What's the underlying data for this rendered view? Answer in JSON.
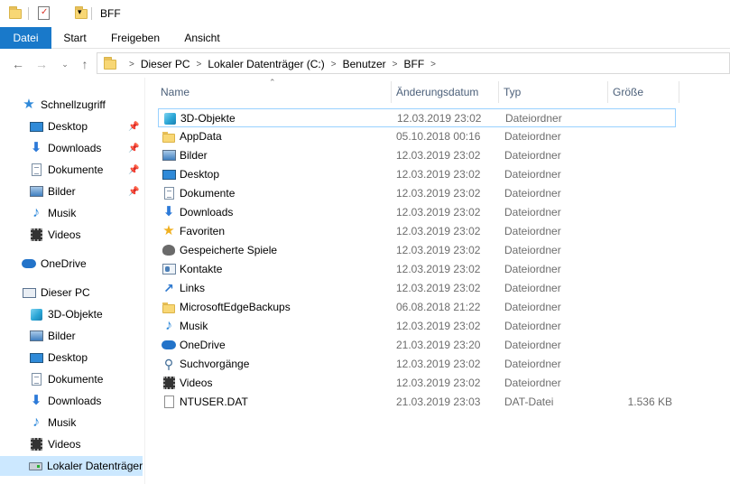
{
  "window": {
    "title": "BFF"
  },
  "ribbon": {
    "tabs": [
      "Datei",
      "Start",
      "Freigeben",
      "Ansicht"
    ]
  },
  "address": {
    "crumbs": [
      "Dieser PC",
      "Lokaler Datenträger (C:)",
      "Benutzer",
      "BFF"
    ]
  },
  "sidebar": {
    "quick_access": "Schnellzugriff",
    "quick_items": [
      "Desktop",
      "Downloads",
      "Dokumente",
      "Bilder",
      "Musik",
      "Videos"
    ],
    "onedrive": "OneDrive",
    "this_pc": "Dieser PC",
    "pc_items": [
      "3D-Objekte",
      "Bilder",
      "Desktop",
      "Dokumente",
      "Downloads",
      "Musik",
      "Videos",
      "Lokaler Datenträger"
    ]
  },
  "columns": {
    "name": "Name",
    "date": "Änderungsdatum",
    "type": "Typ",
    "size": "Größe"
  },
  "files": [
    {
      "name": "3D-Objekte",
      "date": "12.03.2019 23:02",
      "type": "Dateiordner",
      "size": "",
      "icon": "cube-icon"
    },
    {
      "name": "AppData",
      "date": "05.10.2018 00:16",
      "type": "Dateiordner",
      "size": "",
      "icon": "folder-icon"
    },
    {
      "name": "Bilder",
      "date": "12.03.2019 23:02",
      "type": "Dateiordner",
      "size": "",
      "icon": "pictures-icon"
    },
    {
      "name": "Desktop",
      "date": "12.03.2019 23:02",
      "type": "Dateiordner",
      "size": "",
      "icon": "desktop-icon"
    },
    {
      "name": "Dokumente",
      "date": "12.03.2019 23:02",
      "type": "Dateiordner",
      "size": "",
      "icon": "document-icon"
    },
    {
      "name": "Downloads",
      "date": "12.03.2019 23:02",
      "type": "Dateiordner",
      "size": "",
      "icon": "download-icon"
    },
    {
      "name": "Favoriten",
      "date": "12.03.2019 23:02",
      "type": "Dateiordner",
      "size": "",
      "icon": "star-icon"
    },
    {
      "name": "Gespeicherte Spiele",
      "date": "12.03.2019 23:02",
      "type": "Dateiordner",
      "size": "",
      "icon": "game-icon"
    },
    {
      "name": "Kontakte",
      "date": "12.03.2019 23:02",
      "type": "Dateiordner",
      "size": "",
      "icon": "contact-icon"
    },
    {
      "name": "Links",
      "date": "12.03.2019 23:02",
      "type": "Dateiordner",
      "size": "",
      "icon": "link-icon"
    },
    {
      "name": "MicrosoftEdgeBackups",
      "date": "06.08.2018 21:22",
      "type": "Dateiordner",
      "size": "",
      "icon": "folder-icon"
    },
    {
      "name": "Musik",
      "date": "12.03.2019 23:02",
      "type": "Dateiordner",
      "size": "",
      "icon": "music-icon"
    },
    {
      "name": "OneDrive",
      "date": "21.03.2019 23:20",
      "type": "Dateiordner",
      "size": "",
      "icon": "cloud-icon"
    },
    {
      "name": "Suchvorgänge",
      "date": "12.03.2019 23:02",
      "type": "Dateiordner",
      "size": "",
      "icon": "search-icon"
    },
    {
      "name": "Videos",
      "date": "12.03.2019 23:02",
      "type": "Dateiordner",
      "size": "",
      "icon": "video-icon"
    },
    {
      "name": "NTUSER.DAT",
      "date": "21.03.2019 23:03",
      "type": "DAT-Datei",
      "size": "1.536 KB",
      "icon": "file-icon"
    }
  ]
}
